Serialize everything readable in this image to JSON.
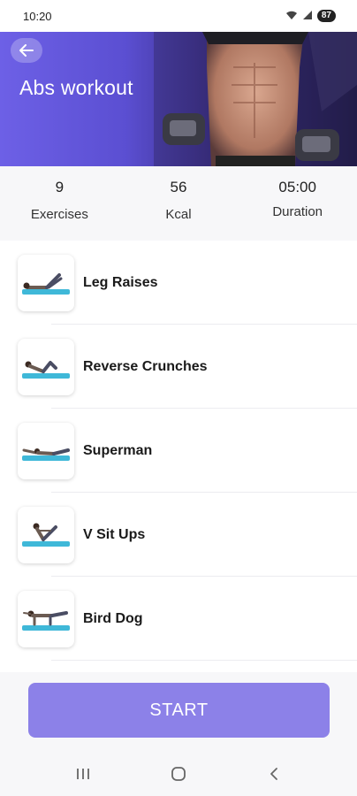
{
  "status_bar": {
    "time": "10:20",
    "battery": "87"
  },
  "header": {
    "title": "Abs workout",
    "back_icon": "arrow-left-icon"
  },
  "stats": [
    {
      "value": "9",
      "label": "Exercises"
    },
    {
      "value": "56",
      "label": "Kcal"
    },
    {
      "value": "05:00",
      "label": "Duration"
    }
  ],
  "exercises": [
    {
      "name": "Leg Raises"
    },
    {
      "name": "Reverse Crunches"
    },
    {
      "name": "Superman"
    },
    {
      "name": "V Sit Ups"
    },
    {
      "name": "Bird Dog"
    }
  ],
  "start_button": {
    "label": "START"
  },
  "colors": {
    "accent": "#8c81e8",
    "hero_gradient_start": "#6d60e6",
    "mat": "#3fb8d8"
  }
}
